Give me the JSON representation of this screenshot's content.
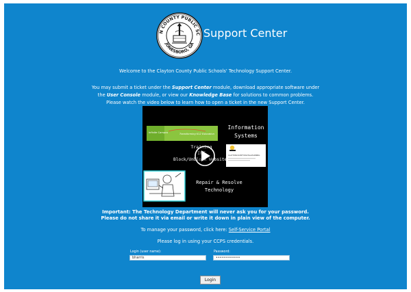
{
  "seal": {
    "top_text": "CLAYTON COUNTY PUBLIC SCHOOLS",
    "bottom_text": "JONESBORO, GA"
  },
  "header": {
    "title": "Support Center"
  },
  "intro": {
    "welcome": "Welcome to the Clayton County Public Schools' Technology Support Center.",
    "p1_a": "You may submit a ticket under the ",
    "p1_b": "Support Center",
    "p1_c": " module, download appropriate software under",
    "p2_a": "the ",
    "p2_b": "User Console",
    "p2_c": " module, or view our ",
    "p2_d": "Knowledge Base",
    "p2_e": " for solutions to common problems.",
    "p3": "Please watch the video below to learn how to open a ticket in the new Support Center."
  },
  "video": {
    "banner_small": "Infinite Campus",
    "banner_tagline": "Transforming K12 Education",
    "info_line1": "Information",
    "info_line2": "Systems",
    "training_line1": "Training",
    "training_line2": "IPT",
    "training_line3": "Block/Unblock Websites",
    "thumb_caption": "CLAYTONCOUNTYDIGITALLEARNING",
    "repair_line1": "Repair & Resolve",
    "repair_line2": "Technology",
    "play_icon": "play-icon"
  },
  "warning": {
    "line1": "Important: The Technology Department will never ask you for your password.",
    "line2": "Please do not share it via email or write it down in plain view of the computer."
  },
  "password_help": {
    "text": "To manage your password, click here: ",
    "link": "Self-Service Portal"
  },
  "login_prompt": "Please log in using your CCPS credentials.",
  "form": {
    "username_label": "Login (user name):",
    "username_value": "bharris",
    "password_label": "Password:",
    "password_value": "••••••••••••",
    "login_button": "Login"
  },
  "colors": {
    "background": "#0f85cd",
    "text": "#ffffff",
    "banner_green": "#8bc53f"
  }
}
